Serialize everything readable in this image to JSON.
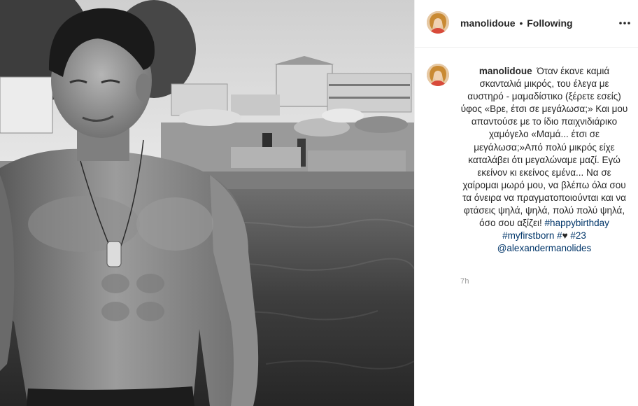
{
  "post": {
    "image_alt": "black and white beach photo",
    "author": "manolidoue",
    "separator": "•",
    "follow_status": "Following",
    "more_icon": "more-options-icon",
    "caption": {
      "username": "manolidoue",
      "text": "Όταν έκανε καμιά σκανταλιά μικρός, του έλεγα με αυστηρό - μαμαδίστικο (ξέρετε εσείς) ύφος «Βρε, έτσι σε μεγάλωσα;» Και μου απαντούσε με το ίδιο παιχνιδιάρικο χαμόγελο «Μαμά... έτσι σε μεγάλωσα;»Από πολύ μικρός είχε καταλάβει ότι μεγαλώναμε μαζί. Εγώ εκείνον κι εκείνος εμένα... Να σε χαίρομαι μωρό μου, να βλέπω όλα σου τα όνειρα να πραγματοποιούνται και να φτάσεις ψηλά, ψηλά, πολύ πολύ ψηλά, όσο σου αξίζει!",
      "hashtag1": "#happybirthday",
      "hashtag2": "#myfirstborn",
      "hashtag3": "#",
      "heart": "♥",
      "hashtag4": "#23",
      "mention": "@alexandermanolides"
    },
    "timestamp": "7h"
  },
  "colors": {
    "link": "#003569",
    "muted": "#999999",
    "text": "#262626",
    "border": "#efefef"
  }
}
